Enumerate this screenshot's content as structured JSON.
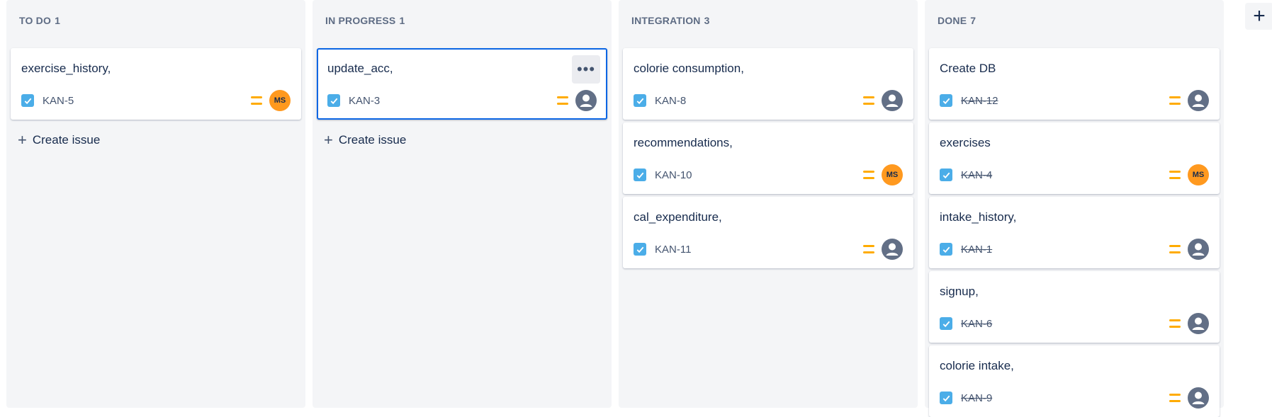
{
  "columns": [
    {
      "id": "todo",
      "title": "TO DO",
      "count": "1",
      "create_label": "Create issue",
      "cards": [
        {
          "title": "exercise_history,",
          "key": "KAN-5",
          "done": false,
          "assignee": "MS",
          "priority_icon": "medium-priority-icon",
          "selected": false
        }
      ]
    },
    {
      "id": "in-progress",
      "title": "IN PROGRESS",
      "count": "1",
      "create_label": "Create issue",
      "cards": [
        {
          "title": "update_acc,",
          "key": "KAN-3",
          "done": false,
          "assignee": "",
          "priority_icon": "medium-priority-icon",
          "selected": true,
          "more_label": "•••"
        }
      ]
    },
    {
      "id": "integration",
      "title": "INTEGRATION",
      "count": "3",
      "cards": [
        {
          "title": "colorie consumption,",
          "key": "KAN-8",
          "done": false,
          "assignee": "",
          "priority_icon": "medium-priority-icon",
          "selected": false
        },
        {
          "title": "recommendations,",
          "key": "KAN-10",
          "done": false,
          "assignee": "MS",
          "priority_icon": "medium-priority-icon",
          "selected": false
        },
        {
          "title": "cal_expenditure,",
          "key": "KAN-11",
          "done": false,
          "assignee": "",
          "priority_icon": "medium-priority-icon",
          "selected": false
        }
      ]
    },
    {
      "id": "done",
      "title": "DONE",
      "count": "7",
      "cards": [
        {
          "title": "Create DB",
          "key": "KAN-12",
          "done": true,
          "assignee": "",
          "priority_icon": "medium-priority-icon",
          "selected": false
        },
        {
          "title": "exercises",
          "key": "KAN-4",
          "done": true,
          "assignee": "MS",
          "priority_icon": "medium-priority-icon",
          "selected": false
        },
        {
          "title": "intake_history,",
          "key": "KAN-1",
          "done": true,
          "assignee": "",
          "priority_icon": "medium-priority-icon",
          "selected": false
        },
        {
          "title": "signup,",
          "key": "KAN-6",
          "done": true,
          "assignee": "",
          "priority_icon": "medium-priority-icon",
          "selected": false
        },
        {
          "title": "colorie intake,",
          "key": "KAN-9",
          "done": true,
          "assignee": "",
          "priority_icon": "medium-priority-icon",
          "selected": false
        }
      ]
    }
  ],
  "add_column_label": "+",
  "colors": {
    "column_bg": "#f4f5f7",
    "checkbox": "#4bade8",
    "priority": "#ffab00",
    "avatar_ms": "#ff991f",
    "selected_border": "#0c66e4"
  }
}
